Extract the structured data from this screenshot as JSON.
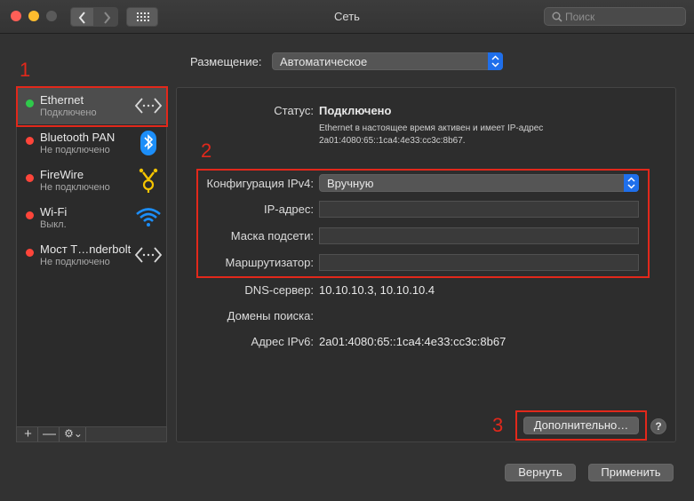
{
  "window": {
    "title": "Сеть"
  },
  "search": {
    "placeholder": "Поиск"
  },
  "location": {
    "label": "Размещение:",
    "value": "Автоматическое"
  },
  "services": [
    {
      "name": "Ethernet",
      "status": "Подключено",
      "dot_color": "#2fc94b",
      "icon": "ethernet-icon"
    },
    {
      "name": "Bluetooth PAN",
      "status": "Не подключено",
      "dot_color": "#ff453a",
      "icon": "bluetooth-icon"
    },
    {
      "name": "FireWire",
      "status": "Не подключено",
      "dot_color": "#ff453a",
      "icon": "firewire-icon"
    },
    {
      "name": "Wi-Fi",
      "status": "Выкл.",
      "dot_color": "#ff453a",
      "icon": "wifi-icon"
    },
    {
      "name": "Мост T…nderbolt",
      "status": "Не подключено",
      "dot_color": "#ff453a",
      "icon": "thunderbolt-bridge-icon"
    }
  ],
  "sidebar_tools": {
    "add": "+",
    "remove": "—",
    "actions": "⚙︎⌄"
  },
  "detail": {
    "status_label": "Статус:",
    "status_value": "Подключено",
    "status_note_line1": "Ethernet в настоящее время активен и имеет IP-адрес",
    "status_note_line2": "2a01:4080:65::1ca4:4e33:cc3c:8b67.",
    "ipv4_config_label": "Конфигурация IPv4:",
    "ipv4_config_value": "Вручную",
    "ip_label": "IP-адрес:",
    "ip_value": "",
    "mask_label": "Маска подсети:",
    "mask_value": "",
    "router_label": "Маршрутизатор:",
    "router_value": "",
    "dns_label": "DNS-сервер:",
    "dns_value": "10.10.10.3, 10.10.10.4",
    "search_domains_label": "Домены поиска:",
    "search_domains_value": "",
    "ipv6_label": "Адрес IPv6:",
    "ipv6_value": "2a01:4080:65::1ca4:4e33:cc3c:8b67"
  },
  "buttons": {
    "advanced": "Дополнительно…",
    "help": "?",
    "revert": "Вернуть",
    "apply": "Применить"
  },
  "annotations": {
    "n1": "1",
    "n2": "2",
    "n3": "3",
    "color": "#e2281b"
  },
  "colors": {
    "accent": "#1f6feb",
    "connected": "#2fc94b",
    "disconnected": "#ff453a"
  }
}
